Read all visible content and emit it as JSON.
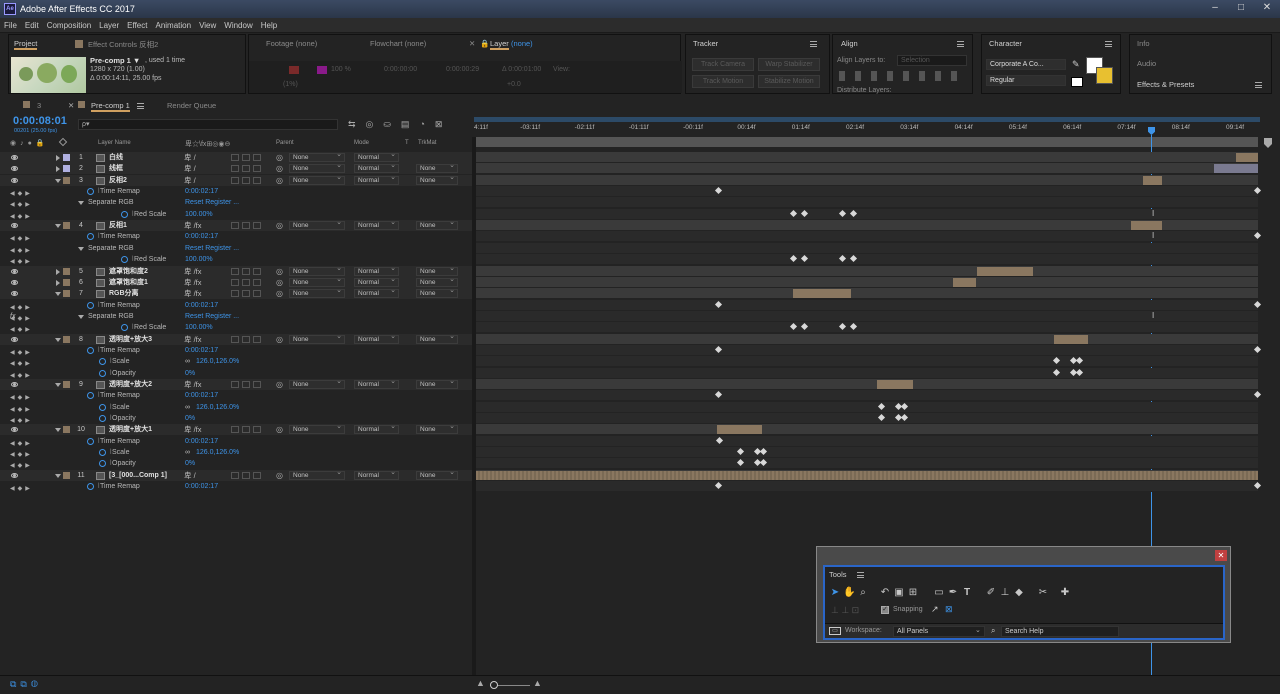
{
  "app": {
    "title": "Adobe After Effects CC 2017",
    "logo": "Ae"
  },
  "menu": [
    "File",
    "Edit",
    "Composition",
    "Layer",
    "Effect",
    "Animation",
    "View",
    "Window",
    "Help"
  ],
  "project_panel": {
    "tabs": [
      "Project",
      "Effect Controls 反相2"
    ],
    "comp_name": "Pre-comp 1 ▼",
    "used": ", used 1 time",
    "dims": "1280 x 720 (1.00)",
    "duration": "Δ 0:00:14:11, 25.00 fps"
  },
  "viewer": {
    "tabs": [
      "Footage (none)",
      "Flowchart (none)",
      "Layer",
      "(none)"
    ],
    "zoom": "100 %",
    "t1": "0:00:00:00",
    "t2": "0:00:00:29",
    "t3": "Δ 0:00:01:00",
    "view": "View:",
    "fit": "(1%)",
    "offset": "+0.0"
  },
  "tracker": {
    "title": "Tracker",
    "buttons": [
      "Track Camera",
      "Warp Stabilizer",
      "Track Motion",
      "Stabilize Motion"
    ]
  },
  "align": {
    "title": "Align",
    "label": "Align Layers to:",
    "value": "Selection",
    "dist": "Distribute Layers:"
  },
  "character": {
    "title": "Character",
    "font": "Corporate A Co...",
    "style": "Regular"
  },
  "right_panels": [
    "Info",
    "Audio",
    "Effects & Presets"
  ],
  "colors": {
    "accent": "#3e94e8",
    "bar": "#8a7760",
    "tool_border": "#2a65c8"
  },
  "timeline": {
    "tabs": [
      "3",
      "Pre-comp 1",
      "Render Queue"
    ],
    "timecode": "0:00:08:01",
    "frames": "00201 (25.00 fps)",
    "search_placeholder": "ρ▾",
    "headers": {
      "layer_name": "Layer Name",
      "switches": "卑☆\\fx⊞◎◉⊖",
      "parent": "Parent",
      "mode": "Mode",
      "t": "T",
      "trkmat": "TrkMat"
    },
    "ruler": [
      "4:11f",
      "-03:11f",
      "-02:11f",
      "-01:11f",
      "-00:11f",
      "00:14f",
      "01:14f",
      "02:14f",
      "03:14f",
      "04:14f",
      "05:14f",
      "06:14f",
      "07:14f",
      "08:14f",
      "09:14f"
    ],
    "rows": [
      {
        "k": "layer",
        "num": "1",
        "name": "白线",
        "color": "#b0b0e0",
        "parent": "None",
        "mode": "Normal",
        "trk": "",
        "sw": "卑  /",
        "bar": [
          760,
          782
        ]
      },
      {
        "k": "layer",
        "num": "2",
        "name": "线框",
        "color": "#b0b0e0",
        "parent": "None",
        "mode": "Normal",
        "trk": "None",
        "sw": "卑  /",
        "bar": [
          738,
          782
        ],
        "barcolor": "#7a7a90"
      },
      {
        "k": "layer",
        "num": "3",
        "name": "反相2",
        "color": "#8a7760",
        "parent": "None",
        "mode": "Normal",
        "trk": "None",
        "sw": "卑  /",
        "open": true,
        "bar": [
          667,
          686
        ]
      },
      {
        "k": "prop",
        "name": "Time Remap",
        "val": "0:00:02:17",
        "ind": 100,
        "kf": [
          240
        ],
        "end": true
      },
      {
        "k": "fx",
        "name": "Separate RGB",
        "val": "Reset   Register      ...",
        "ind": 88
      },
      {
        "k": "prop",
        "name": "Red Scale",
        "val": "100.00%",
        "ind": 134,
        "kf": [
          315,
          326,
          364,
          375
        ],
        "mark": 676
      },
      {
        "k": "layer",
        "num": "4",
        "name": "反相1",
        "color": "#8a7760",
        "parent": "None",
        "mode": "Normal",
        "trk": "None",
        "sw": "卑  /fx",
        "open": true,
        "bar": [
          655,
          686
        ]
      },
      {
        "k": "prop",
        "name": "Time Remap",
        "val": "0:00:02:17",
        "ind": 100,
        "kf": [],
        "mark": 676,
        "end": true
      },
      {
        "k": "fx",
        "name": "Separate RGB",
        "val": "Reset   Register      ...",
        "ind": 88
      },
      {
        "k": "prop",
        "name": "Red Scale",
        "val": "100.00%",
        "ind": 134,
        "kf": [
          315,
          326,
          364,
          375
        ]
      },
      {
        "k": "layer",
        "num": "5",
        "name": "遮罩饱和度2",
        "color": "#8a7760",
        "parent": "None",
        "mode": "Normal",
        "trk": "None",
        "sw": "卑  /fx",
        "bar": [
          501,
          557
        ]
      },
      {
        "k": "layer",
        "num": "6",
        "name": "遮罩饱和度1",
        "color": "#8a7760",
        "parent": "None",
        "mode": "Normal",
        "trk": "None",
        "sw": "卑  /fx",
        "bar": [
          477,
          500
        ]
      },
      {
        "k": "layer",
        "num": "7",
        "name": "RGB分离",
        "color": "#8a7760",
        "parent": "None",
        "mode": "Normal",
        "trk": "None",
        "sw": "卑  /fx",
        "open": true,
        "bar": [
          317,
          375
        ]
      },
      {
        "k": "prop",
        "name": "Time Remap",
        "val": "0:00:02:17",
        "ind": 100,
        "kf": [
          240
        ],
        "end": true
      },
      {
        "k": "fx",
        "name": "Separate RGB",
        "val": "Reset   Register      ...",
        "ind": 88,
        "fxicon": true,
        "mark": 676
      },
      {
        "k": "prop",
        "name": "Red Scale",
        "val": "100.00%",
        "ind": 134,
        "kf": [
          315,
          326,
          364,
          375
        ]
      },
      {
        "k": "layer",
        "num": "8",
        "name": "透明度+放大3",
        "color": "#8a7760",
        "parent": "None",
        "mode": "Normal",
        "trk": "None",
        "sw": "卑  /fx",
        "open": true,
        "bar": [
          578,
          612
        ]
      },
      {
        "k": "prop",
        "name": "Time Remap",
        "val": "0:00:02:17",
        "ind": 100,
        "kf": [
          240
        ],
        "end": true
      },
      {
        "k": "prop",
        "name": "Scale",
        "val": "126.0,126.0%",
        "ind": 112,
        "link": true,
        "kf": [
          578,
          595,
          601
        ]
      },
      {
        "k": "prop",
        "name": "Opacity",
        "val": "0%",
        "ind": 112,
        "kf": [
          578,
          595,
          601
        ]
      },
      {
        "k": "layer",
        "num": "9",
        "name": "透明度+放大2",
        "color": "#8a7760",
        "parent": "None",
        "mode": "Normal",
        "trk": "None",
        "sw": "卑  /fx",
        "open": true,
        "bar": [
          401,
          437
        ]
      },
      {
        "k": "prop",
        "name": "Time Remap",
        "val": "0:00:02:17",
        "ind": 100,
        "kf": [
          240
        ],
        "end": true
      },
      {
        "k": "prop",
        "name": "Scale",
        "val": "126.0,126.0%",
        "ind": 112,
        "link": true,
        "kf": [
          403,
          420,
          426
        ]
      },
      {
        "k": "prop",
        "name": "Opacity",
        "val": "0%",
        "ind": 112,
        "kf": [
          403,
          420,
          426
        ]
      },
      {
        "k": "layer",
        "num": "10",
        "name": "透明度+放大1",
        "color": "#8a7760",
        "parent": "None",
        "mode": "Normal",
        "trk": "None",
        "sw": "卑  /fx",
        "open": true,
        "bar": [
          241,
          286
        ]
      },
      {
        "k": "prop",
        "name": "Time Remap",
        "val": "0:00:02:17",
        "ind": 100,
        "kf": [
          241
        ]
      },
      {
        "k": "prop",
        "name": "Scale",
        "val": "126.0,126.0%",
        "ind": 112,
        "link": true,
        "kf": [
          262,
          279,
          285
        ]
      },
      {
        "k": "prop",
        "name": "Opacity",
        "val": "0%",
        "ind": 112,
        "kf": [
          262,
          279,
          285
        ]
      },
      {
        "k": "layer",
        "num": "11",
        "name": "[3_[000...Comp 1]",
        "color": "#8a7760",
        "parent": "None",
        "mode": "Normal",
        "trk": "None",
        "sw": "卑  /",
        "open": true,
        "bar": [
          0,
          782
        ],
        "striped": true
      },
      {
        "k": "prop",
        "name": "Time Remap",
        "val": "0:00:02:17",
        "ind": 100,
        "kf": [
          240
        ],
        "end": true
      }
    ]
  },
  "tools": {
    "title": "Tools",
    "snapping": "Snapping",
    "workspace_label": "Workspace:",
    "workspace_value": "All Panels",
    "search_help": "Search Help"
  }
}
